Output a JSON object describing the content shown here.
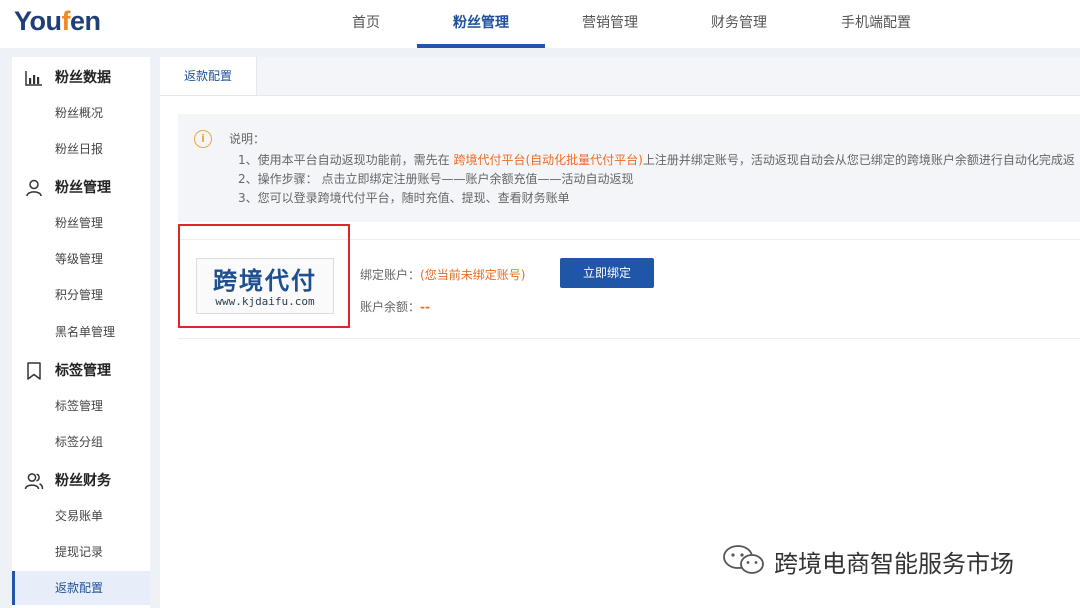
{
  "header": {
    "logo_prefix": "You",
    "logo_f": "f",
    "logo_suffix": "en",
    "nav": [
      "首页",
      "粉丝管理",
      "营销管理",
      "财务管理",
      "手机端配置"
    ],
    "active_nav": "粉丝管理"
  },
  "sidebar": {
    "groups": [
      {
        "label": "粉丝数据",
        "icon": "bar-chart-icon",
        "items": [
          "粉丝概况",
          "粉丝日报"
        ]
      },
      {
        "label": "粉丝管理",
        "icon": "user-icon",
        "items": [
          "粉丝管理",
          "等级管理",
          "积分管理",
          "黑名单管理"
        ]
      },
      {
        "label": "标签管理",
        "icon": "bookmark-icon",
        "items": [
          "标签管理",
          "标签分组"
        ]
      },
      {
        "label": "粉丝财务",
        "icon": "users-icon",
        "items": [
          "交易账单",
          "提现记录",
          "返款配置"
        ]
      }
    ],
    "active_item": "返款配置"
  },
  "main": {
    "tab": "返款配置",
    "notice": {
      "icon": "info-icon",
      "title": "说明：",
      "line1_before": "1、使用本平台自动返现功能前，需先在 ",
      "line1_highlight": "跨境代付平台(自动化批量代付平台)",
      "line1_after": "上注册并绑定账号，活动返现自动会从您已绑定的跨境账户余额进行自动化完成返",
      "line2": "2、操作步骤： 点击立即绑定注册账号——账户余额充值——活动自动返现",
      "line3": "3、您可以登录跨境代付平台，随时充值、提现、查看财务账单"
    },
    "account": {
      "brand_name": "跨境代付",
      "brand_url": "www.kjdaifu.com",
      "bind_label": "绑定账户：",
      "bind_status": "(您当前未绑定账号)",
      "bind_button": "立即绑定",
      "balance_label": "账户余额：",
      "balance_value": "--"
    }
  },
  "watermark": {
    "icon": "wechat-icon",
    "text": "跨境电商智能服务市场"
  },
  "colors": {
    "primary": "#1f56a8",
    "accent_orange": "#ef6b22",
    "highlight_box": "#e1262b",
    "logo_blue": "#1f3f78",
    "logo_orange": "#f08a24"
  }
}
